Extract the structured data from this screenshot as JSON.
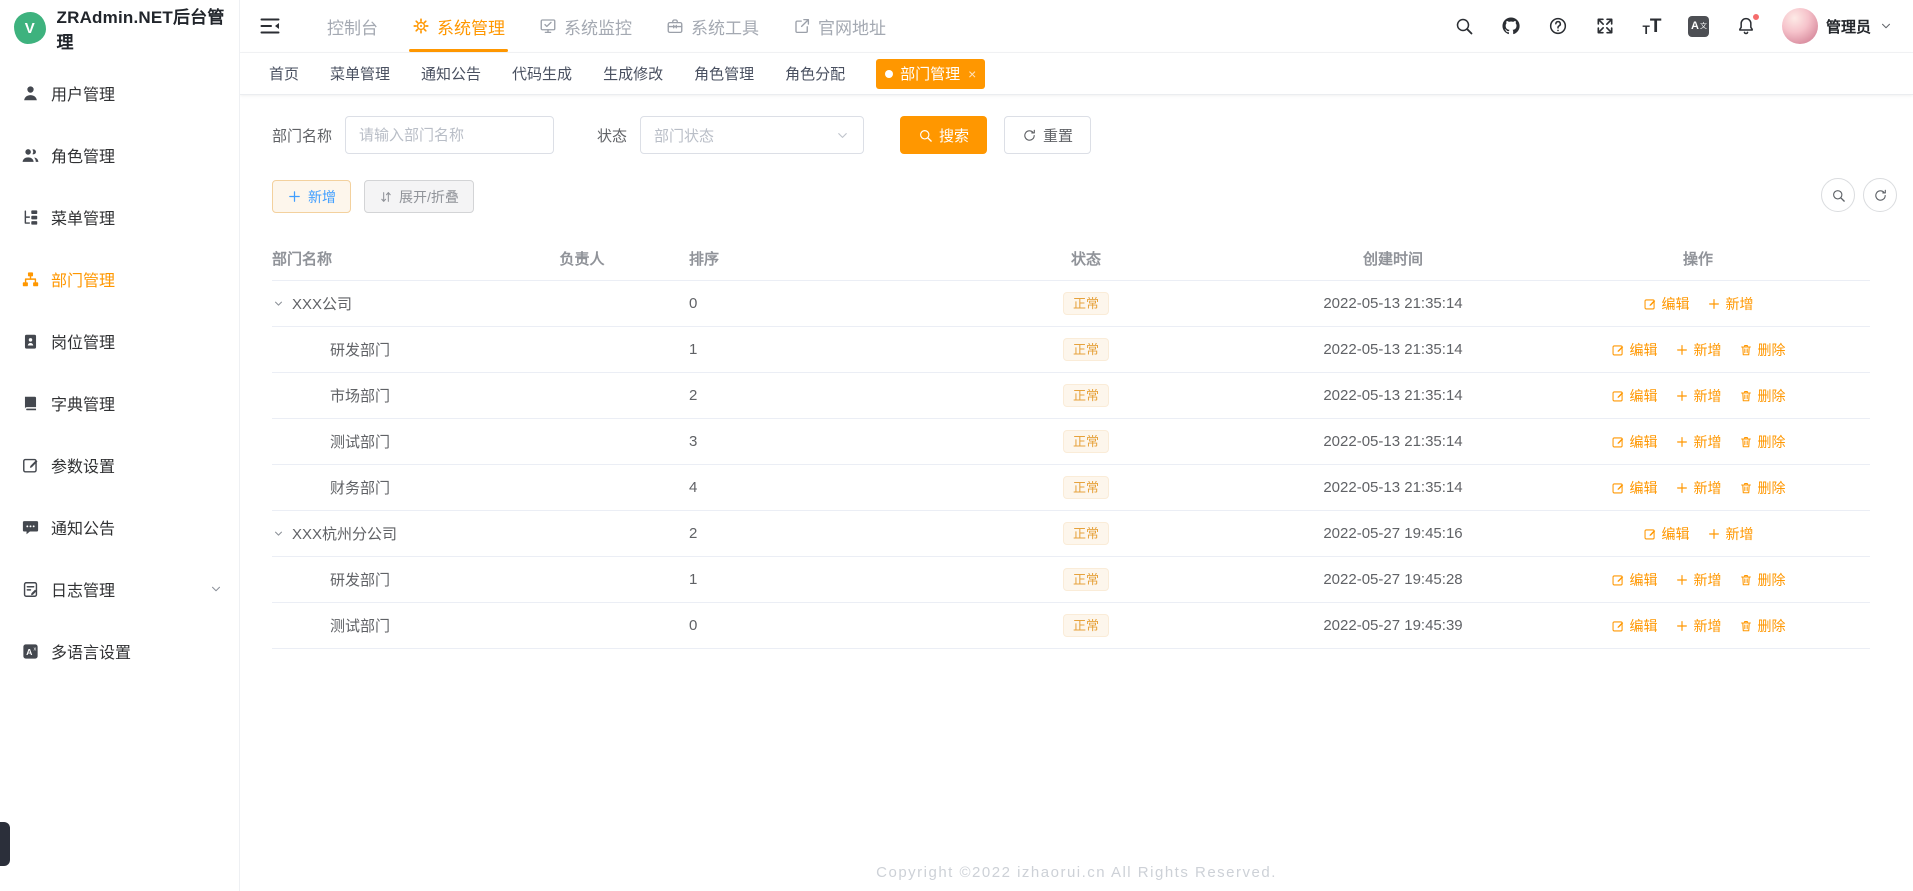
{
  "app": {
    "title": "ZRAdmin.NET后台管理",
    "logo_letter": "V"
  },
  "colors": {
    "primary": "#ff9700",
    "logo_green": "#3eb27e",
    "badge_text": "#e6a23c",
    "badge_bg": "#fdf6ec",
    "notice_dot": "#f56c6c"
  },
  "sidebar": {
    "items": [
      {
        "icon": "user-icon",
        "label": "用户管理",
        "active": false,
        "expandable": false
      },
      {
        "icon": "users-icon",
        "label": "角色管理",
        "active": false,
        "expandable": false
      },
      {
        "icon": "tree-table-icon",
        "label": "菜单管理",
        "active": false,
        "expandable": false
      },
      {
        "icon": "sitemap-icon",
        "label": "部门管理",
        "active": true,
        "expandable": false
      },
      {
        "icon": "id-badge-icon",
        "label": "岗位管理",
        "active": false,
        "expandable": false
      },
      {
        "icon": "dict-book-icon",
        "label": "字典管理",
        "active": false,
        "expandable": false
      },
      {
        "icon": "edit-square-icon",
        "label": "参数设置",
        "active": false,
        "expandable": false
      },
      {
        "icon": "comment-icon",
        "label": "通知公告",
        "active": false,
        "expandable": false
      },
      {
        "icon": "log-icon",
        "label": "日志管理",
        "active": false,
        "expandable": true
      },
      {
        "icon": "language-square-icon",
        "label": "多语言设置",
        "active": false,
        "expandable": false
      }
    ]
  },
  "topnav": {
    "items": [
      {
        "label": "控制台",
        "icon": null,
        "active": false
      },
      {
        "label": "系统管理",
        "icon": "gear-icon",
        "active": true
      },
      {
        "label": "系统监控",
        "icon": "monitor-icon",
        "active": false
      },
      {
        "label": "系统工具",
        "icon": "toolbox-icon",
        "active": false
      },
      {
        "label": "官网地址",
        "icon": "external-link-icon",
        "active": false
      }
    ]
  },
  "topbar": {
    "icons": [
      {
        "name": "search-icon",
        "glyph": "search",
        "badge": false
      },
      {
        "name": "github-icon",
        "glyph": "github",
        "badge": false
      },
      {
        "name": "help-icon",
        "glyph": "question",
        "badge": false
      },
      {
        "name": "fullscreen-icon",
        "glyph": "fullscreen",
        "badge": false
      },
      {
        "name": "font-size-icon",
        "glyph": "fontsize",
        "badge": false
      },
      {
        "name": "translate-icon",
        "glyph": "langbox",
        "badge": false
      },
      {
        "name": "bell-icon",
        "glyph": "bell",
        "badge": true
      }
    ],
    "user": {
      "name": "管理员"
    }
  },
  "tabs": {
    "items": [
      {
        "label": "首页",
        "active": false,
        "closable": false
      },
      {
        "label": "菜单管理",
        "active": false,
        "closable": false
      },
      {
        "label": "通知公告",
        "active": false,
        "closable": false
      },
      {
        "label": "代码生成",
        "active": false,
        "closable": false
      },
      {
        "label": "生成修改",
        "active": false,
        "closable": false
      },
      {
        "label": "角色管理",
        "active": false,
        "closable": false
      },
      {
        "label": "角色分配",
        "active": false,
        "closable": false
      },
      {
        "label": "部门管理",
        "active": true,
        "closable": true
      }
    ],
    "close_glyph": "×"
  },
  "filters": {
    "name_label": "部门名称",
    "name_placeholder": "请输入部门名称",
    "name_value": "",
    "status_label": "状态",
    "status_placeholder": "部门状态",
    "search_label": "搜索",
    "reset_label": "重置"
  },
  "toolbar": {
    "add_label": "新增",
    "expand_label": "展开/折叠"
  },
  "table": {
    "columns": [
      "部门名称",
      "负责人",
      "排序",
      "状态",
      "创建时间",
      "操作"
    ],
    "action_labels": {
      "edit": "编辑",
      "add": "新增",
      "delete": "删除"
    },
    "rows": [
      {
        "name": "XXX公司",
        "level": 0,
        "expanded": true,
        "leader": "",
        "sort": 0,
        "status": "正常",
        "created": "2022-05-13 21:35:14",
        "actions": [
          "edit",
          "add"
        ]
      },
      {
        "name": "研发部门",
        "level": 1,
        "expanded": false,
        "leader": "",
        "sort": 1,
        "status": "正常",
        "created": "2022-05-13 21:35:14",
        "actions": [
          "edit",
          "add",
          "delete"
        ]
      },
      {
        "name": "市场部门",
        "level": 1,
        "expanded": false,
        "leader": "",
        "sort": 2,
        "status": "正常",
        "created": "2022-05-13 21:35:14",
        "actions": [
          "edit",
          "add",
          "delete"
        ]
      },
      {
        "name": "测试部门",
        "level": 1,
        "expanded": false,
        "leader": "",
        "sort": 3,
        "status": "正常",
        "created": "2022-05-13 21:35:14",
        "actions": [
          "edit",
          "add",
          "delete"
        ]
      },
      {
        "name": "财务部门",
        "level": 1,
        "expanded": false,
        "leader": "",
        "sort": 4,
        "status": "正常",
        "created": "2022-05-13 21:35:14",
        "actions": [
          "edit",
          "add",
          "delete"
        ]
      },
      {
        "name": "XXX杭州分公司",
        "level": 0,
        "expanded": true,
        "leader": "",
        "sort": 2,
        "status": "正常",
        "created": "2022-05-27 19:45:16",
        "actions": [
          "edit",
          "add"
        ]
      },
      {
        "name": "研发部门",
        "level": 1,
        "expanded": false,
        "leader": "",
        "sort": 1,
        "status": "正常",
        "created": "2022-05-27 19:45:28",
        "actions": [
          "edit",
          "add",
          "delete"
        ]
      },
      {
        "name": "测试部门",
        "level": 1,
        "expanded": false,
        "leader": "",
        "sort": 0,
        "status": "正常",
        "created": "2022-05-27 19:45:39",
        "actions": [
          "edit",
          "add",
          "delete"
        ]
      }
    ]
  },
  "footer": {
    "copyright": "Copyright ©2022 izhaorui.cn All Rights Reserved."
  }
}
